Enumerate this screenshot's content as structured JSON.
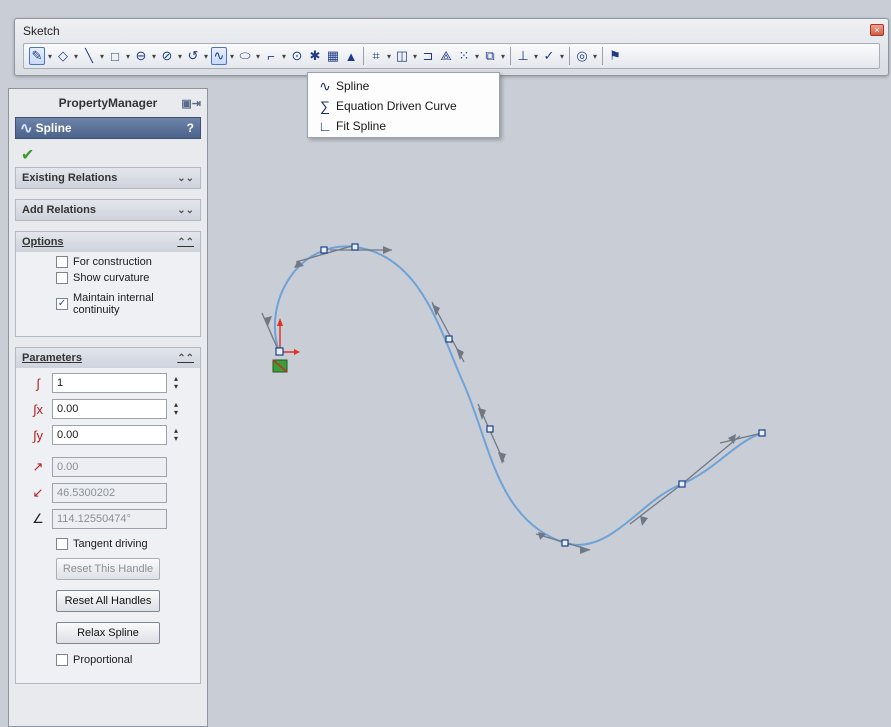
{
  "toolbar": {
    "title": "Sketch"
  },
  "dropdown": {
    "items": [
      {
        "label": "Spline"
      },
      {
        "label": "Equation Driven Curve"
      },
      {
        "label": "Fit Spline"
      }
    ]
  },
  "property_manager": {
    "title": "PropertyManager",
    "feature_name": "Spline",
    "help": "?",
    "sections": {
      "existing_relations": "Existing Relations",
      "add_relations": "Add Relations",
      "options": "Options",
      "parameters": "Parameters"
    },
    "options": {
      "for_construction": "For construction",
      "show_curvature": "Show curvature",
      "maintain_continuity": "Maintain internal continuity"
    },
    "parameters": {
      "point_number": "1",
      "x_coordinate": "0.00",
      "y_coordinate": "0.00",
      "tangent_weight_1": "0.00",
      "tangent_weight_2": "46.5300202",
      "tangent_angle": "114.12550474°"
    },
    "tangent_driving": "Tangent driving",
    "reset_this_handle": "Reset This Handle",
    "reset_all_handles": "Reset All Handles",
    "relax_spline": "Relax Spline",
    "proportional": "Proportional"
  },
  "colors": {
    "spline": "#6fa3d8",
    "handle": "#707884",
    "point": "#1c3f8a",
    "accent": "#4b628a"
  }
}
